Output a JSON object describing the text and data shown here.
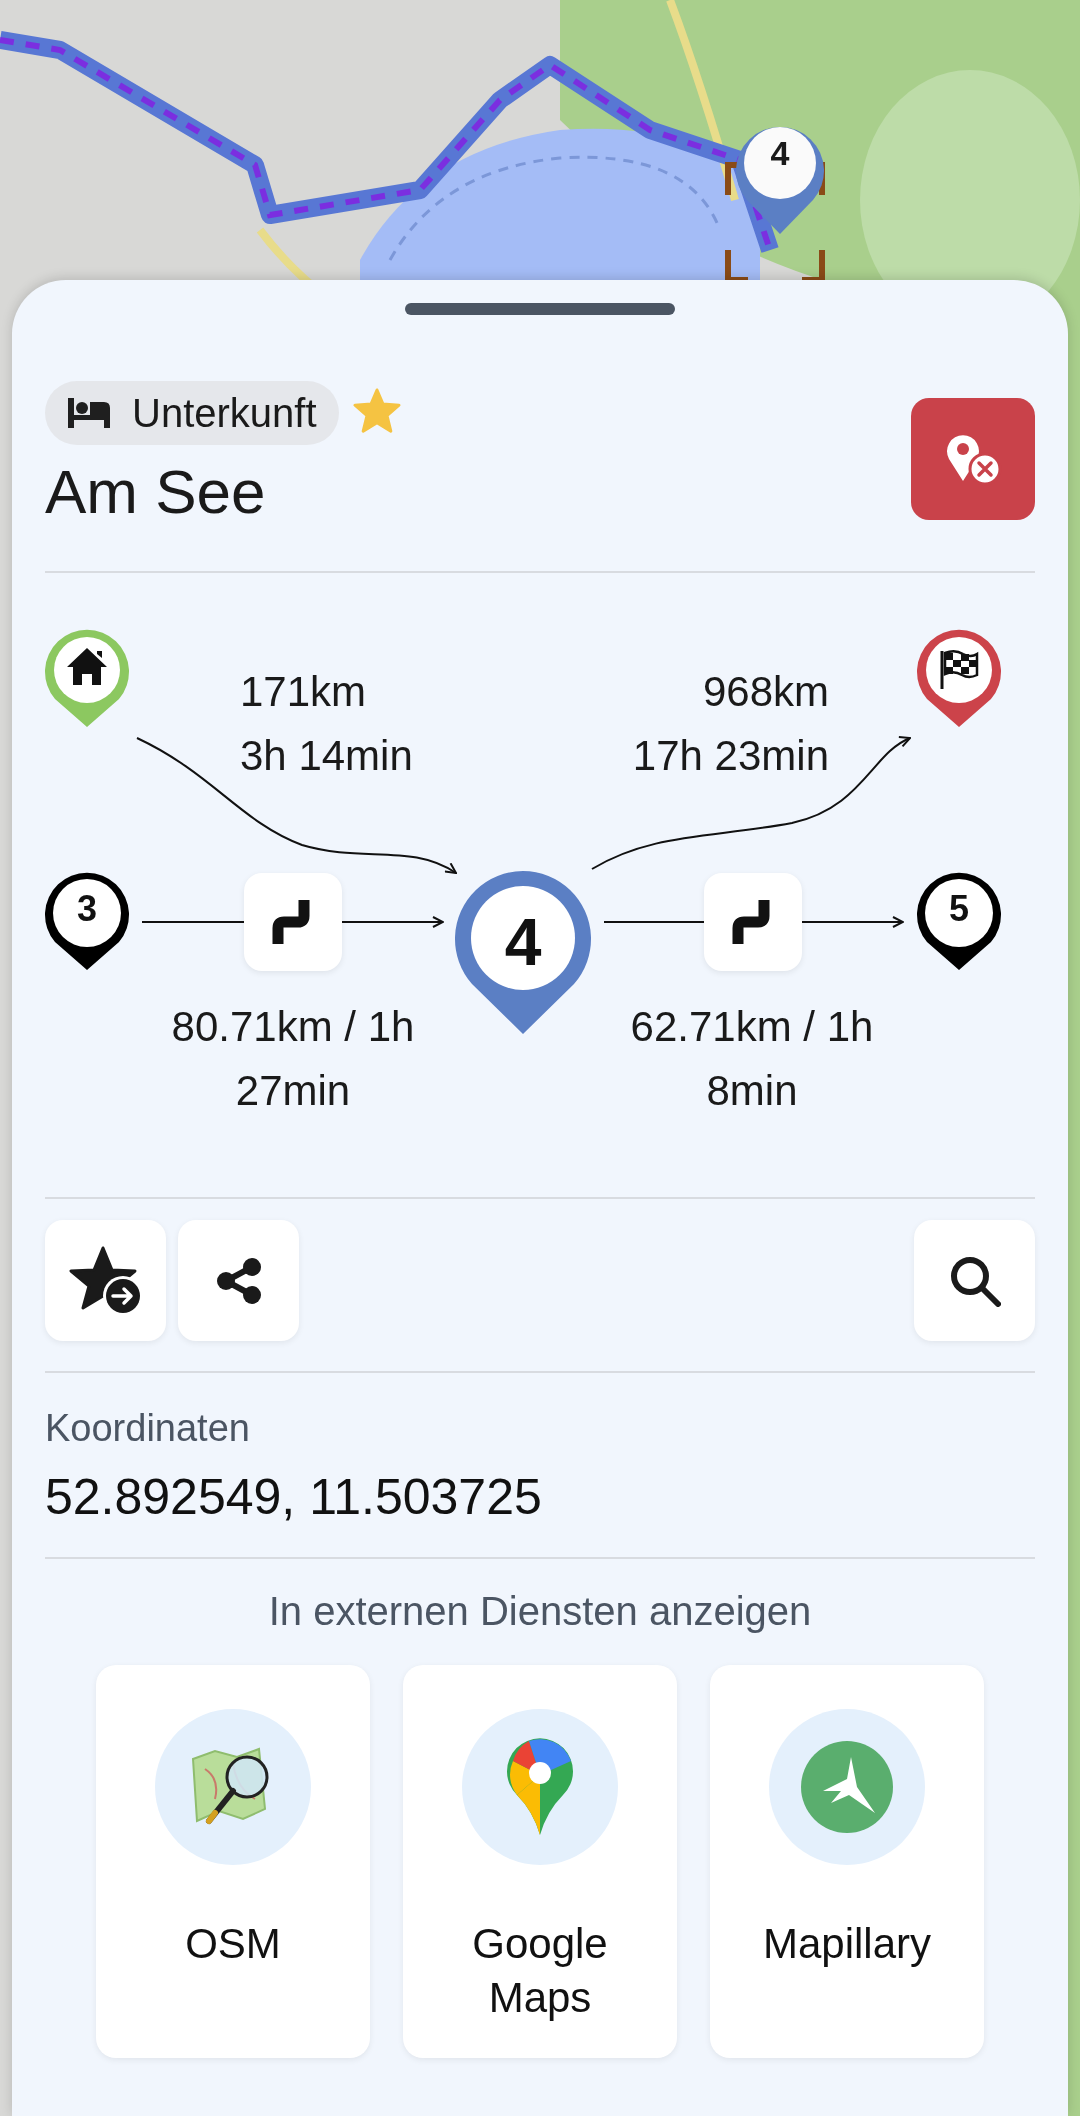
{
  "map": {
    "marker": {
      "label": "4"
    }
  },
  "place": {
    "category": "Unterkunft",
    "favorite": true,
    "name": "Am See"
  },
  "route": {
    "previous": {
      "label": "3"
    },
    "current": {
      "label": "4"
    },
    "next": {
      "label": "5"
    },
    "from_start": {
      "distance": "171km",
      "duration": "3h 14min"
    },
    "to_end": {
      "distance": "968km",
      "duration": "17h 23min"
    },
    "previous_leg": "80.71km / 1h 27min",
    "next_leg": "62.71km / 1h 8min"
  },
  "coordinates": {
    "label": "Koordinaten",
    "value": "52.892549, 11.503725"
  },
  "external": {
    "title": "In externen Diensten anzeigen",
    "services": [
      {
        "name": "OSM",
        "kind": "osm"
      },
      {
        "name": "Google Maps",
        "kind": "google"
      },
      {
        "name": "Mapillary",
        "kind": "mapillary"
      }
    ]
  }
}
